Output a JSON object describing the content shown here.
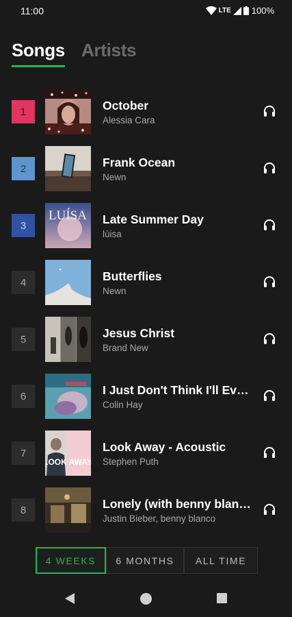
{
  "status": {
    "time": "11:00",
    "network": "LTE",
    "battery": "100%"
  },
  "tabs": [
    {
      "label": "Songs",
      "active": true
    },
    {
      "label": "Artists",
      "active": false
    }
  ],
  "songs": [
    {
      "rank": "1",
      "title": "October",
      "artist": "Alessia Cara",
      "rank_color": "#e0365f",
      "rank_text_color": "#4a0a1a"
    },
    {
      "rank": "2",
      "title": "Frank Ocean",
      "artist": "Newn",
      "rank_color": "#5e95cf",
      "rank_text_color": "#1b3a5e"
    },
    {
      "rank": "3",
      "title": "Late Summer Day",
      "artist": "lùisa",
      "rank_color": "#2f53a3",
      "rank_text_color": "#c8d4ee"
    },
    {
      "rank": "4",
      "title": "Butterflies",
      "artist": "Newn",
      "rank_color": "#2c2c2c",
      "rank_text_color": "#aaaaaa"
    },
    {
      "rank": "5",
      "title": "Jesus Christ",
      "artist": "Brand New",
      "rank_color": "#2c2c2c",
      "rank_text_color": "#aaaaaa"
    },
    {
      "rank": "6",
      "title": "I Just Don't Think I'll Ever Get Over You",
      "artist": "Colin Hay",
      "rank_color": "#2c2c2c",
      "rank_text_color": "#aaaaaa"
    },
    {
      "rank": "7",
      "title": "Look Away - Acoustic",
      "artist": "Stephen Puth",
      "rank_color": "#2c2c2c",
      "rank_text_color": "#aaaaaa"
    },
    {
      "rank": "8",
      "title": "Lonely (with benny blanco)",
      "artist": "Justin Bieber, benny blanco",
      "rank_color": "#2c2c2c",
      "rank_text_color": "#aaaaaa"
    }
  ],
  "covers": {
    "luisa_text": "LUÍSA",
    "look_away_text": "LOOK AWAY"
  },
  "period": [
    {
      "label": "4 WEEKS",
      "active": true
    },
    {
      "label": "6 MONTHS",
      "active": false
    },
    {
      "label": "ALL TIME",
      "active": false
    }
  ],
  "icons": {
    "listen": "headphones-icon",
    "back": "back-triangle-icon",
    "home": "home-circle-icon",
    "recents": "recents-square-icon"
  },
  "colors": {
    "accent": "#1db954",
    "background": "#1b1a1a"
  }
}
